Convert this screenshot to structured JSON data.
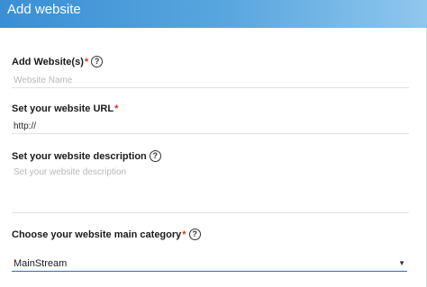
{
  "header": {
    "title": "Add website"
  },
  "fields": {
    "website_name": {
      "label": "Add Website(s)",
      "required": "*",
      "placeholder": "Website Name",
      "help": "?"
    },
    "website_url": {
      "label": "Set your website URL",
      "required": "*",
      "value": "http://"
    },
    "description": {
      "label": "Set your website description",
      "placeholder": "Set your website description",
      "help": "?"
    },
    "category": {
      "label": "Choose your website main category",
      "required": "*",
      "help": "?",
      "selected": "MainStream"
    }
  },
  "colors": {
    "header_start": "#3a8fd4",
    "header_end": "#8fc7ee",
    "required": "#d9301f",
    "focus_underline": "#2d6cc9"
  }
}
